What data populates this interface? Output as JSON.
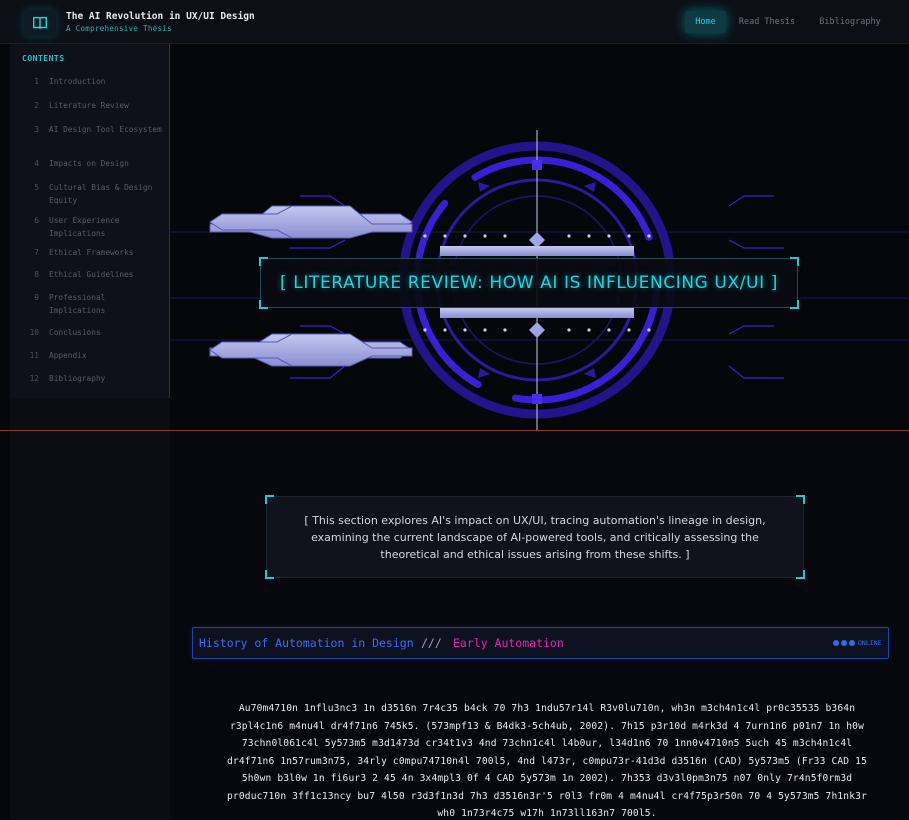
{
  "header": {
    "logo_icon": "book-icon",
    "title": "The AI Revolution in UX/UI Design",
    "subtitle": "A Comprehensive Thesis",
    "nav": [
      "Home",
      "Read Thesis",
      "Bibliography"
    ],
    "active_nav": "Home"
  },
  "sidebar": {
    "title": "CONTENTS",
    "items": [
      {
        "num": "1",
        "label": "Introduction"
      },
      {
        "num": "2",
        "label": "Literature Review"
      },
      {
        "num": "3",
        "label": "AI Design Tool Ecosystem"
      },
      {
        "num": "4",
        "label": "Impacts on Design"
      },
      {
        "num": "5",
        "label": "Cultural Bias & Design Equity"
      },
      {
        "num": "6",
        "label": "User Experience Implications"
      },
      {
        "num": "7",
        "label": "Ethical Frameworks"
      },
      {
        "num": "8",
        "label": "Ethical Guidelines"
      },
      {
        "num": "9",
        "label": "Professional Implications"
      },
      {
        "num": "10",
        "label": "Conclusions"
      },
      {
        "num": "11",
        "label": "Appendix"
      },
      {
        "num": "12",
        "label": "Bibliography"
      }
    ]
  },
  "hero": {
    "title": "[ LITERATURE REVIEW: HOW AI IS INFLUENCING UX/UI ]"
  },
  "summary": {
    "text": "[ This section explores AI's impact on UX/UI, tracing automation's lineage in design, examining the current landscape of AI-powered tools, and critically assessing the theoretical and ethical issues arising from these shifts. ]"
  },
  "section": {
    "main": "History of Automation in Design",
    "separator": "///",
    "sub": "Early Automation",
    "status": "ONLINE"
  },
  "body": {
    "lines": [
      "Au70m4710n 1nflu3nc3 1n d3516n 7r4c35 b4ck 70 7h3 1ndu57r14l R3v0lu710n, wh3n m3ch4n1c4l pr0c35535 b364n",
      "r3pl4c1n6 m4nu4l dr4f71n6 745k5. (573mpf13 & B4dk3-5ch4ub, 2002). 7h15 p3r10d m4rk3d 4 7urn1n6 p01n7 1n h0w",
      "73chn0l061c4l 5y573m5 m3d1473d cr34t1v3 4nd 73chn1c4l l4b0ur, l34d1n6 70 1nn0v4710n5 5uch 45 m3ch4n1c4l",
      "dr4f71n6 1n57rum3n75, 34rly c0mpu74710n4l 700l5, 4nd l473r, c0mpu73r-41d3d d3516n (CAD) 5y573m5 (Fr33 CAD 15",
      "5h0wn b3l0w 1n fi6ur3 2 45 4n 3x4mpl3 0f 4 CAD 5y573m 1n 2002). 7h353 d3v3l0pm3n75 n07 0nly 7r4n5f0rm3d",
      "pr0duc710n 3ff1c13ncy bu7 4l50 r3d3f1n3d 7h3 d3516n3r'5 r0l3 fr0m 4 m4nu4l cr4f75p3r50n 70 4 5y573m5 7h1nk3r",
      "wh0 1n73r4c75 w17h 1n73ll163n7 700l5."
    ]
  },
  "colors": {
    "accent": "#19d7e2",
    "section_blue": "#3a6ef0",
    "section_magenta": "#e524b8",
    "hero_purple": "#3a1fd0"
  }
}
